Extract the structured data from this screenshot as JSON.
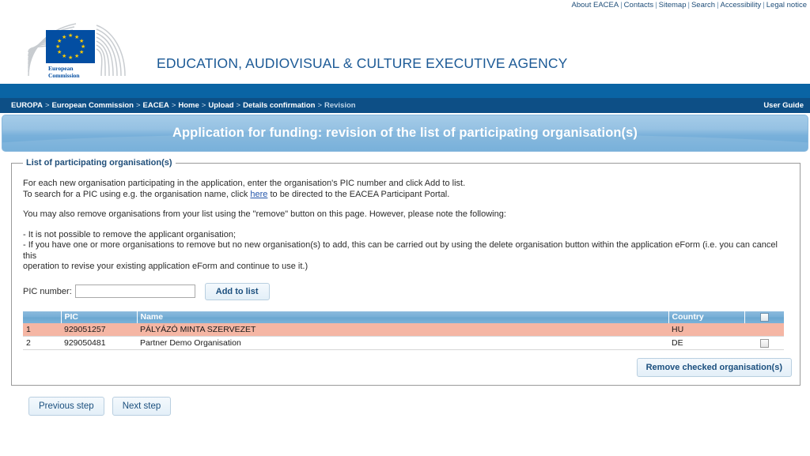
{
  "topbar": {
    "links": [
      "About EACEA",
      "Contacts",
      "Sitemap",
      "Search",
      "Accessibility",
      "Legal notice"
    ],
    "separator": "|"
  },
  "masthead": {
    "logo_line_1": "European",
    "logo_line_2": "Commission",
    "agency_title": "EDUCATION, AUDIOVISUAL & CULTURE EXECUTIVE AGENCY"
  },
  "breadcrumb": {
    "items": [
      "EUROPA",
      "European Commission",
      "EACEA",
      "Home",
      "Upload",
      "Details confirmation"
    ],
    "current": "Revision",
    "arrow": ">",
    "user_guide": "User Guide"
  },
  "page": {
    "title": "Application for funding: revision of the list of participating organisation(s)"
  },
  "panel": {
    "legend": "List of participating organisation(s)",
    "paragraph_1_line_1": "For each new organisation participating in the application, enter the organisation's PIC number and click Add to list.",
    "paragraph_1_line_2_pre": "To search for a PIC using e.g. the organisation name, click ",
    "paragraph_1_link": "here",
    "paragraph_1_line_2_post": " to be directed to the EACEA Participant Portal.",
    "paragraph_2": "You may also remove organisations from your list using the \"remove\" button on this page. However, please note the following:",
    "paragraph_3_line_1": "- It is not possible to remove the applicant organisation;",
    "paragraph_3_line_2": "- If you have one or more organisations to remove but no new organisation(s) to add, this can be carried out by using the delete organisation button within the application eForm (i.e. you can cancel this",
    "paragraph_3_line_3": "operation to revise your existing application eForm and continue to use it.)"
  },
  "pic_form": {
    "label": "PIC number:",
    "input_value": "",
    "input_placeholder": "",
    "add_button": "Add to list"
  },
  "table": {
    "headers": {
      "index": "",
      "pic": "PIC",
      "name": "Name",
      "country": "Country",
      "check": ""
    },
    "rows": [
      {
        "index": "1",
        "pic": "929051257",
        "name": "PÁLYÁZÓ MINTA SZERVEZET",
        "country": "HU",
        "has_checkbox": false,
        "checked": false,
        "is_applicant": true
      },
      {
        "index": "2",
        "pic": "929050481",
        "name": "Partner Demo Organisation",
        "country": "DE",
        "has_checkbox": true,
        "checked": false,
        "is_applicant": false
      }
    ],
    "remove_button": "Remove checked organisation(s)"
  },
  "footer": {
    "previous_step": "Previous step",
    "next_step": "Next step"
  },
  "colors": {
    "brand_blue": "#0d4f86",
    "band_blue": "#0a64a4",
    "title_blue": "#1c5a96",
    "banner_blue": "#79b0da",
    "table_header_blue": "#76aed6",
    "applicant_row": "#f5b6a4",
    "link_blue": "#2255aa",
    "flag_blue": "#034ea2",
    "star_yellow": "#ffcc00"
  }
}
